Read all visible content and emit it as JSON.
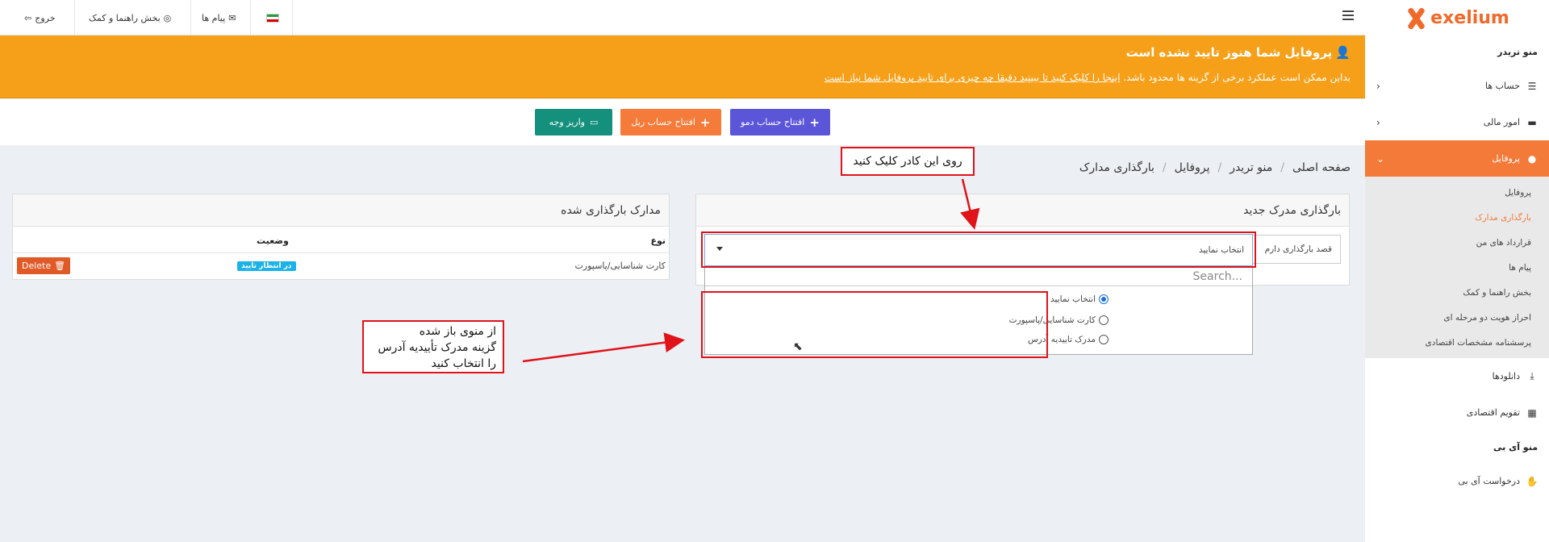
{
  "brand": {
    "name": "exelium"
  },
  "colors": {
    "accent": "#f37a39",
    "alert": "#f6a019",
    "demo": "#5b55d8",
    "real": "#f57b3a",
    "deposit": "#15907c",
    "annotation": "#e0121a"
  },
  "sidebar": {
    "section_trader": "منو تریدر",
    "items": [
      {
        "label": "حساب ها",
        "icon": "list-icon"
      },
      {
        "label": "امور مالی",
        "icon": "wallet-icon"
      },
      {
        "label": "پروفایل",
        "icon": "user-icon"
      }
    ],
    "profile_sub": [
      "پروفایل",
      "بارگذاری مدارک",
      "قرارداد های من",
      "پیام ها",
      "بخش راهنما و کمک",
      "احراز هویت دو مرحله ای",
      "پرسشنامه مشخصات اقتصادی"
    ],
    "downloads": "دانلودها",
    "calendar": "تقویم اقتصادی",
    "section_ib": "منو آی بی",
    "ib_request": "درخواست آی بی"
  },
  "topbar": {
    "logout": "خروج",
    "help": "بخش راهنما و کمک",
    "messages": "پیام ها"
  },
  "alert": {
    "title": "پروفایل شما هنوز تایید نشده است",
    "msg_part1": "بداین ممکن است عملکرد برخی از گزینه ها محدود باشد. ",
    "msg_link": "اینجا را کلیک کنید تا ببینید دقیقا چه چیزی برای تایید پروفایل شما نیاز است"
  },
  "buttons": {
    "demo": "افتتاح حساب دمو",
    "real": "افتتاح حساب ریل",
    "deposit": "واریز وجه"
  },
  "breadcrumb": [
    "صفحه اصلی",
    "منو تریدر",
    "پروفایل",
    "بارگذاری مدارک"
  ],
  "uploaded_panel": {
    "title": "مدارک بارگذاری شده",
    "col_type": "نوع",
    "col_status": "وضعیت",
    "row_type": "کارت شناسایی/پاسپورت",
    "row_status": "در انتظار تایید",
    "delete_label": "Delete"
  },
  "new_panel": {
    "title": "بارگذاری مدرک جدید",
    "intent_placeholder": "قصد بارگذاری دارم",
    "select_value": "انتخاب نمایید"
  },
  "dropdown": {
    "search_placeholder": "Search...",
    "options": [
      {
        "label": "انتخاب نمایید",
        "checked": true
      },
      {
        "label": "کارت شناسایی/پاسپورت",
        "checked": false
      },
      {
        "label": "مدرک تاییدیه آدرس",
        "checked": false
      }
    ]
  },
  "annotations": {
    "click_box": "روی این کادر کلیک کنید",
    "note_line1": "از منوی باز شده",
    "note_line2": "گزینه مدرک تأییدیه آدرس",
    "note_line3": "را انتخاب کنید"
  }
}
